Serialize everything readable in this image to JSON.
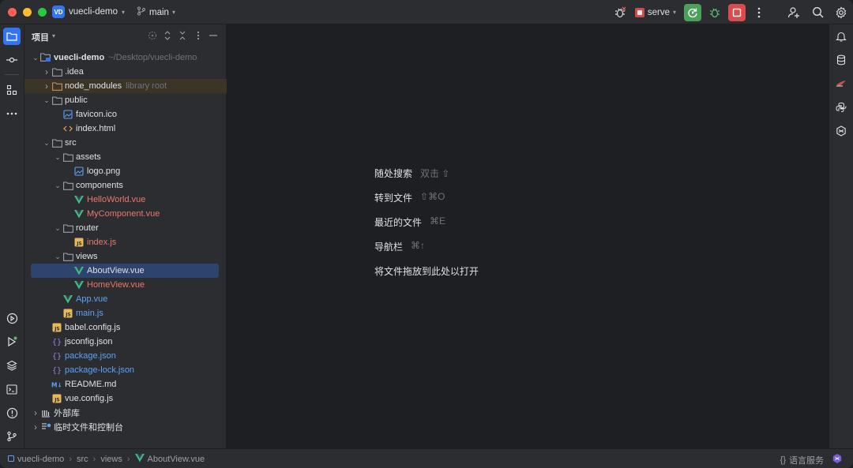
{
  "titlebar": {
    "project_badge": "VD",
    "project_name": "vuecli-demo",
    "branch": "main",
    "run_config": "serve"
  },
  "panel": {
    "title": "项目"
  },
  "tree": [
    {
      "label": "vuecli-demo",
      "hint": "~/Desktop/vuecli-demo",
      "depth": 0,
      "arrow": "open",
      "icon": "folder-module-icon",
      "color": "normal",
      "bold": true
    },
    {
      "label": ".idea",
      "hint": "",
      "depth": 1,
      "arrow": "closed",
      "icon": "folder-icon",
      "color": "normal"
    },
    {
      "label": "node_modules",
      "hint": "library root",
      "depth": 1,
      "arrow": "closed",
      "icon": "folder-lib-icon",
      "color": "normal",
      "lib": true
    },
    {
      "label": "public",
      "hint": "",
      "depth": 1,
      "arrow": "open",
      "icon": "folder-icon",
      "color": "normal"
    },
    {
      "label": "favicon.ico",
      "hint": "",
      "depth": 2,
      "arrow": "",
      "icon": "image-file-icon",
      "color": "normal"
    },
    {
      "label": "index.html",
      "hint": "",
      "depth": 2,
      "arrow": "",
      "icon": "html-file-icon",
      "color": "normal"
    },
    {
      "label": "src",
      "hint": "",
      "depth": 1,
      "arrow": "open",
      "icon": "folder-icon",
      "color": "normal"
    },
    {
      "label": "assets",
      "hint": "",
      "depth": 2,
      "arrow": "open",
      "icon": "folder-icon",
      "color": "normal"
    },
    {
      "label": "logo.png",
      "hint": "",
      "depth": 3,
      "arrow": "",
      "icon": "image-file-icon",
      "color": "normal"
    },
    {
      "label": "components",
      "hint": "",
      "depth": 2,
      "arrow": "open",
      "icon": "folder-icon",
      "color": "normal"
    },
    {
      "label": "HelloWorld.vue",
      "hint": "",
      "depth": 3,
      "arrow": "",
      "icon": "vue-file-icon",
      "color": "red"
    },
    {
      "label": "MyComponent.vue",
      "hint": "",
      "depth": 3,
      "arrow": "",
      "icon": "vue-file-icon",
      "color": "red"
    },
    {
      "label": "router",
      "hint": "",
      "depth": 2,
      "arrow": "open",
      "icon": "folder-icon",
      "color": "normal"
    },
    {
      "label": "index.js",
      "hint": "",
      "depth": 3,
      "arrow": "",
      "icon": "js-file-icon",
      "color": "red"
    },
    {
      "label": "views",
      "hint": "",
      "depth": 2,
      "arrow": "open",
      "icon": "folder-icon",
      "color": "normal"
    },
    {
      "label": "AboutView.vue",
      "hint": "",
      "depth": 3,
      "arrow": "",
      "icon": "vue-file-icon",
      "color": "normal",
      "selected": true
    },
    {
      "label": "HomeView.vue",
      "hint": "",
      "depth": 3,
      "arrow": "",
      "icon": "vue-file-icon",
      "color": "red"
    },
    {
      "label": "App.vue",
      "hint": "",
      "depth": 2,
      "arrow": "",
      "icon": "vue-file-icon",
      "color": "blue"
    },
    {
      "label": "main.js",
      "hint": "",
      "depth": 2,
      "arrow": "",
      "icon": "js-file-icon",
      "color": "blue"
    },
    {
      "label": "babel.config.js",
      "hint": "",
      "depth": 1,
      "arrow": "",
      "icon": "js-file-icon",
      "color": "normal"
    },
    {
      "label": "jsconfig.json",
      "hint": "",
      "depth": 1,
      "arrow": "",
      "icon": "json-file-icon",
      "color": "normal"
    },
    {
      "label": "package.json",
      "hint": "",
      "depth": 1,
      "arrow": "",
      "icon": "json-file-icon",
      "color": "blue"
    },
    {
      "label": "package-lock.json",
      "hint": "",
      "depth": 1,
      "arrow": "",
      "icon": "json-file-icon",
      "color": "blue"
    },
    {
      "label": "README.md",
      "hint": "",
      "depth": 1,
      "arrow": "",
      "icon": "markdown-file-icon",
      "color": "normal"
    },
    {
      "label": "vue.config.js",
      "hint": "",
      "depth": 1,
      "arrow": "",
      "icon": "js-file-icon",
      "color": "normal"
    },
    {
      "label": "外部库",
      "hint": "",
      "depth": 0,
      "arrow": "closed",
      "icon": "library-icon",
      "color": "normal"
    },
    {
      "label": "临时文件和控制台",
      "hint": "",
      "depth": 0,
      "arrow": "closed",
      "icon": "scratch-icon",
      "color": "normal"
    }
  ],
  "editor_hints": [
    {
      "action": "随处搜索",
      "shortcut": "双击 ⇧"
    },
    {
      "action": "转到文件",
      "shortcut": "⇧⌘O"
    },
    {
      "action": "最近的文件",
      "shortcut": "⌘E"
    },
    {
      "action": "导航栏",
      "shortcut": "⌘↑"
    },
    {
      "action": "将文件拖放到此处以打开",
      "shortcut": ""
    }
  ],
  "statusbar": {
    "crumbs": [
      "vuecli-demo",
      "src",
      "views",
      "AboutView.vue"
    ],
    "language_services": "语言服务"
  },
  "colors": {
    "accent": "#3574f0",
    "vue_green": "#42b883",
    "red_file": "#e8786d",
    "blue_file": "#5fa2f5",
    "selection": "#2e436e"
  }
}
